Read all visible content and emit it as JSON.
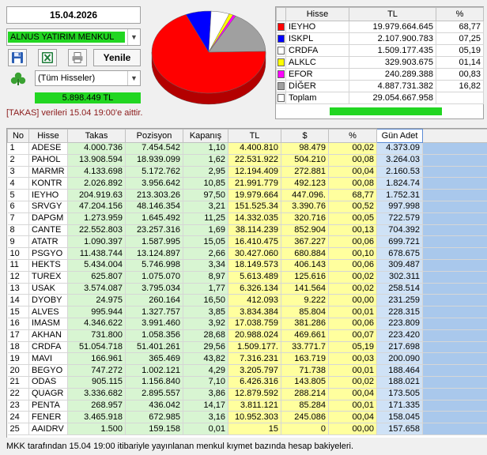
{
  "date": "15.04.2026",
  "member": "ALNUS YATIRIM MENKUL",
  "toolbar": {
    "refresh_label": "Yenile"
  },
  "stock_filter": "(Tüm Hisseler)",
  "total": "5.898.449 TL",
  "takas_note": "[TAKAS] verileri 15.04 19:00'e aittir.",
  "colors": {
    "accent_green": "#22d622",
    "col_green": "#d8f5d2",
    "col_yellow": "#ffff9e",
    "col_blue": "#cfe2f6"
  },
  "summary": {
    "headers": [
      "Hisse",
      "TL",
      "%"
    ],
    "rows": [
      {
        "color": "#ff0000",
        "name": "IEYHO",
        "tl": "19.979.664.645",
        "pct": "68,77"
      },
      {
        "color": "#0000ff",
        "name": "ISKPL",
        "tl": "2.107.900.783",
        "pct": "07,25"
      },
      {
        "color": "#ffffff",
        "name": "CRDFA",
        "tl": "1.509.177.435",
        "pct": "05,19"
      },
      {
        "color": "#ffff00",
        "name": "ALKLC",
        "tl": "329.903.675",
        "pct": "01,14"
      },
      {
        "color": "#ff00ff",
        "name": "EFOR",
        "tl": "240.289.388",
        "pct": "00,83"
      },
      {
        "color": "#a0a0a0",
        "name": "DİĞER",
        "tl": "4.887.731.382",
        "pct": "16,82"
      },
      {
        "color": "#ffffff",
        "name": "Toplam",
        "tl": "29.054.667.958",
        "pct": ""
      }
    ]
  },
  "pie": {
    "slices": [
      {
        "name": "IEYHO",
        "value": 68.77,
        "color": "#ff0000"
      },
      {
        "name": "ISKPL",
        "value": 7.25,
        "color": "#0000ff"
      },
      {
        "name": "CRDFA",
        "value": 5.19,
        "color": "#ffffff"
      },
      {
        "name": "ALKLC",
        "value": 1.14,
        "color": "#ffff00"
      },
      {
        "name": "EFOR",
        "value": 0.83,
        "color": "#ff00ff"
      },
      {
        "name": "DİĞER",
        "value": 16.82,
        "color": "#a0a0a0"
      }
    ]
  },
  "grid": {
    "headers": [
      "No",
      "Hisse",
      "Takas",
      "Pozisyon",
      "Kapanış",
      "TL",
      "$",
      "%",
      "Gün Adet"
    ],
    "rows": [
      [
        "1",
        "ADESE",
        "4.000.736",
        "7.454.542",
        "1,10",
        "4.400.810",
        "98.479",
        "00,02",
        "4.373.09"
      ],
      [
        "2",
        "PAHOL",
        "13.908.594",
        "18.939.099",
        "1,62",
        "22.531.922",
        "504.210",
        "00,08",
        "3.264.03"
      ],
      [
        "3",
        "MARMR",
        "4.133.698",
        "5.172.762",
        "2,95",
        "12.194.409",
        "272.881",
        "00,04",
        "2.160.53"
      ],
      [
        "4",
        "KONTR",
        "2.026.892",
        "3.956.642",
        "10,85",
        "21.991.779",
        "492.123",
        "00,08",
        "1.824.74"
      ],
      [
        "5",
        "IEYHO",
        "204.919.63",
        "213.303.26",
        "97,50",
        "19.979.664",
        "447.096.",
        "68,77",
        "1.752.31"
      ],
      [
        "6",
        "SRVGY",
        "47.204.156",
        "48.146.354",
        "3,21",
        "151.525.34",
        "3.390.76",
        "00,52",
        "997.998"
      ],
      [
        "7",
        "DAPGM",
        "1.273.959",
        "1.645.492",
        "11,25",
        "14.332.035",
        "320.716",
        "00,05",
        "722.579"
      ],
      [
        "8",
        "CANTE",
        "22.552.803",
        "23.257.316",
        "1,69",
        "38.114.239",
        "852.904",
        "00,13",
        "704.392"
      ],
      [
        "9",
        "ATATR",
        "1.090.397",
        "1.587.995",
        "15,05",
        "16.410.475",
        "367.227",
        "00,06",
        "699.721"
      ],
      [
        "10",
        "PSGYO",
        "11.438.744",
        "13.124.897",
        "2,66",
        "30.427.060",
        "680.884",
        "00,10",
        "678.675"
      ],
      [
        "11",
        "HEKTS",
        "5.434.004",
        "5.746.998",
        "3,34",
        "18.149.573",
        "406.143",
        "00,06",
        "309.487"
      ],
      [
        "12",
        "TUREX",
        "625.807",
        "1.075.070",
        "8,97",
        "5.613.489",
        "125.616",
        "00,02",
        "302.311"
      ],
      [
        "13",
        "USAK",
        "3.574.087",
        "3.795.034",
        "1,77",
        "6.326.134",
        "141.564",
        "00,02",
        "258.514"
      ],
      [
        "14",
        "DYOBY",
        "24.975",
        "260.164",
        "16,50",
        "412.093",
        "9.222",
        "00,00",
        "231.259"
      ],
      [
        "15",
        "ALVES",
        "995.944",
        "1.327.757",
        "3,85",
        "3.834.384",
        "85.804",
        "00,01",
        "228.315"
      ],
      [
        "16",
        "IMASM",
        "4.346.622",
        "3.991.460",
        "3,92",
        "17.038.759",
        "381.286",
        "00,06",
        "223.809"
      ],
      [
        "17",
        "AKHAN",
        "731.800",
        "1.058.356",
        "28,68",
        "20.988.024",
        "469.661",
        "00,07",
        "223.420"
      ],
      [
        "18",
        "CRDFA",
        "51.054.718",
        "51.401.261",
        "29,56",
        "1.509.177.",
        "33.771.7",
        "05,19",
        "217.698"
      ],
      [
        "19",
        "MAVI",
        "166.961",
        "365.469",
        "43,82",
        "7.316.231",
        "163.719",
        "00,03",
        "200.090"
      ],
      [
        "20",
        "BEGYO",
        "747.272",
        "1.002.121",
        "4,29",
        "3.205.797",
        "71.738",
        "00,01",
        "188.464"
      ],
      [
        "21",
        "ODAS",
        "905.115",
        "1.156.840",
        "7,10",
        "6.426.316",
        "143.805",
        "00,02",
        "188.021"
      ],
      [
        "22",
        "QUAGR",
        "3.336.682",
        "2.895.557",
        "3,86",
        "12.879.592",
        "288.214",
        "00,04",
        "173.505"
      ],
      [
        "23",
        "PENTA",
        "268.957",
        "436.042",
        "14,17",
        "3.811.121",
        "85.284",
        "00,01",
        "171.335"
      ],
      [
        "24",
        "FENER",
        "3.465.918",
        "672.985",
        "3,16",
        "10.952.303",
        "245.086",
        "00,04",
        "158.045"
      ],
      [
        "25",
        "AAIDRV",
        "1.500",
        "159.158",
        "0,01",
        "15",
        "0",
        "00,00",
        "157.658"
      ]
    ]
  },
  "footer": "MKK tarafından 15.04 19:00 itibariyle yayınlanan menkul kıymet bazında hesap bakiyeleri."
}
